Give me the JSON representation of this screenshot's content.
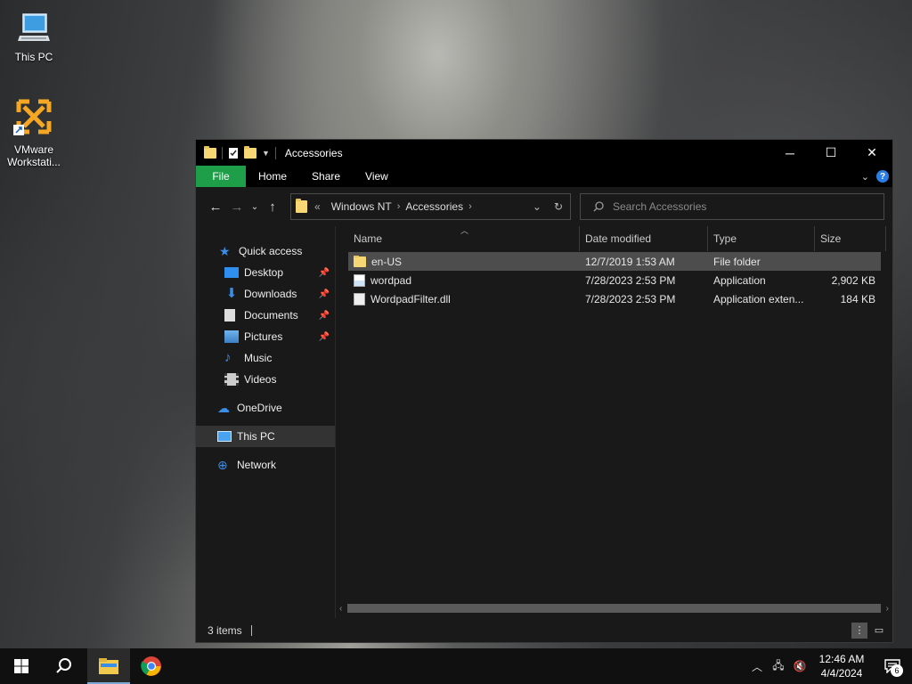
{
  "desktop": {
    "icons": [
      {
        "label": "This PC",
        "icon": "monitor-icon"
      },
      {
        "label": "VMware Workstati...",
        "icon": "vmware-icon"
      }
    ]
  },
  "window": {
    "title": "Accessories",
    "controls": {
      "minimize": "─",
      "maximize": "☐",
      "close": "✕"
    },
    "ribbon": {
      "file": "File",
      "home": "Home",
      "share": "Share",
      "view": "View"
    },
    "address": {
      "overflow": "«",
      "crumbs": [
        "Windows NT",
        "Accessories"
      ]
    },
    "search": {
      "placeholder": "Search Accessories"
    },
    "sidebar": {
      "items": [
        {
          "label": "Quick access",
          "icon": "star-icon",
          "pinned": false
        },
        {
          "label": "Desktop",
          "icon": "desktop-folder-icon",
          "pinned": true
        },
        {
          "label": "Downloads",
          "icon": "download-arrow-icon",
          "pinned": true
        },
        {
          "label": "Documents",
          "icon": "documents-icon",
          "pinned": true
        },
        {
          "label": "Pictures",
          "icon": "pictures-icon",
          "pinned": true
        },
        {
          "label": "Music",
          "icon": "music-note-icon",
          "pinned": false
        },
        {
          "label": "Videos",
          "icon": "videos-icon",
          "pinned": false
        },
        {
          "label": "OneDrive",
          "icon": "cloud-icon",
          "pinned": false
        },
        {
          "label": "This PC",
          "icon": "computer-icon",
          "pinned": false,
          "selected": true
        },
        {
          "label": "Network",
          "icon": "network-icon",
          "pinned": false
        }
      ]
    },
    "columns": [
      "Name",
      "Date modified",
      "Type",
      "Size"
    ],
    "files": [
      {
        "name": "en-US",
        "date": "12/7/2019 1:53 AM",
        "type": "File folder",
        "size": "",
        "icon": "folder-icon",
        "selected": true
      },
      {
        "name": "wordpad",
        "date": "7/28/2023 2:53 PM",
        "type": "Application",
        "size": "2,902 KB",
        "icon": "wordpad-icon"
      },
      {
        "name": "WordpadFilter.dll",
        "date": "7/28/2023 2:53 PM",
        "type": "Application exten...",
        "size": "184 KB",
        "icon": "dll-icon"
      }
    ],
    "status": {
      "items_count": "3 items"
    }
  },
  "taskbar": {
    "clock_time": "12:46 AM",
    "clock_date": "4/4/2024",
    "notification_count": "6"
  },
  "colors": {
    "file_tab": "#1e9e48",
    "folder": "#f7d774",
    "accent": "#2a7de1"
  }
}
